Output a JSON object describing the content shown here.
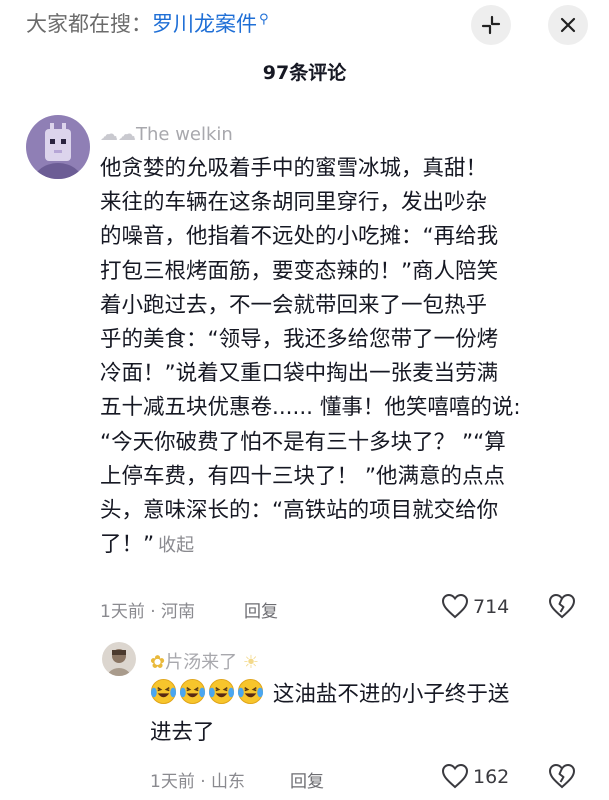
{
  "header": {
    "search_prefix": "大家都在搜：",
    "search_keyword": "罗川龙案件",
    "comment_count_title": "97条评论"
  },
  "icons": {
    "minimize": "collapse-arrows-icon",
    "close": "close-icon",
    "search": "search-icon",
    "like": "heart-outline-icon",
    "dislike": "broken-heart-icon"
  },
  "colors": {
    "keyword": "#1f6fd6",
    "secondary_text": "#8a8a8f",
    "text": "#161823"
  },
  "comments": [
    {
      "username": "The welkin",
      "lines": [
        "他贪婪的允吸着手中的蜜雪冰城，真甜！",
        "来往的车辆在这条胡同里穿行，发出吵杂",
        "的噪音，他指着不远处的小吃摊：“再给我",
        "打包三根烤面筋，要变态辣的！”商人陪笑",
        "着小跑过去，不一会就带回来了一包热乎",
        "乎的美食：“领导，我还多给您带了一份烤",
        "冷面！”说着又重口袋中掏出一张麦当劳满",
        "五十减五块优惠卷...... 懂事！他笑嘻嘻的说:",
        "“今天你破费了怕不是有三十多块了？ ”“算",
        "上停车费，有四十三块了！ ”他满意的点点",
        "头，意味深长的：“高铁站的项目就交给你",
        "了！”"
      ],
      "collapse_label": "收起",
      "time_location": "1天前 · 河南",
      "reply_label": "回复",
      "likes": "714"
    },
    {
      "username": "片汤来了",
      "emoji_prefix": "😭😭😭😭",
      "line1": "这油盐不进的小子终于送",
      "line2": "进去了",
      "time_location": "1天前 · 山东",
      "reply_label": "回复",
      "likes": "162"
    }
  ]
}
